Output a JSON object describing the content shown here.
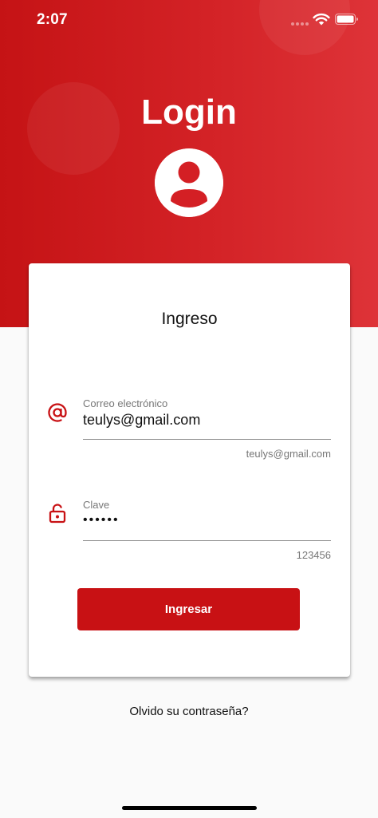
{
  "status_bar": {
    "time": "2:07"
  },
  "header": {
    "title": "Login",
    "avatar_icon": "account-circle-icon",
    "gradient_colors": [
      "#c51315",
      "#de3338"
    ]
  },
  "card": {
    "title": "Ingreso",
    "email": {
      "icon": "at-sign-icon",
      "label": "Correo electrónico",
      "value": "teulys@gmail.com",
      "helper": "teulys@gmail.com"
    },
    "password": {
      "icon": "lock-open-icon",
      "label": "Clave",
      "value": "••••••",
      "helper": "123456"
    },
    "submit_label": "Ingresar"
  },
  "forgot_password": "Olvido su contraseña?",
  "colors": {
    "accent": "#c81114",
    "background": "#fafafa",
    "card": "#ffffff"
  }
}
